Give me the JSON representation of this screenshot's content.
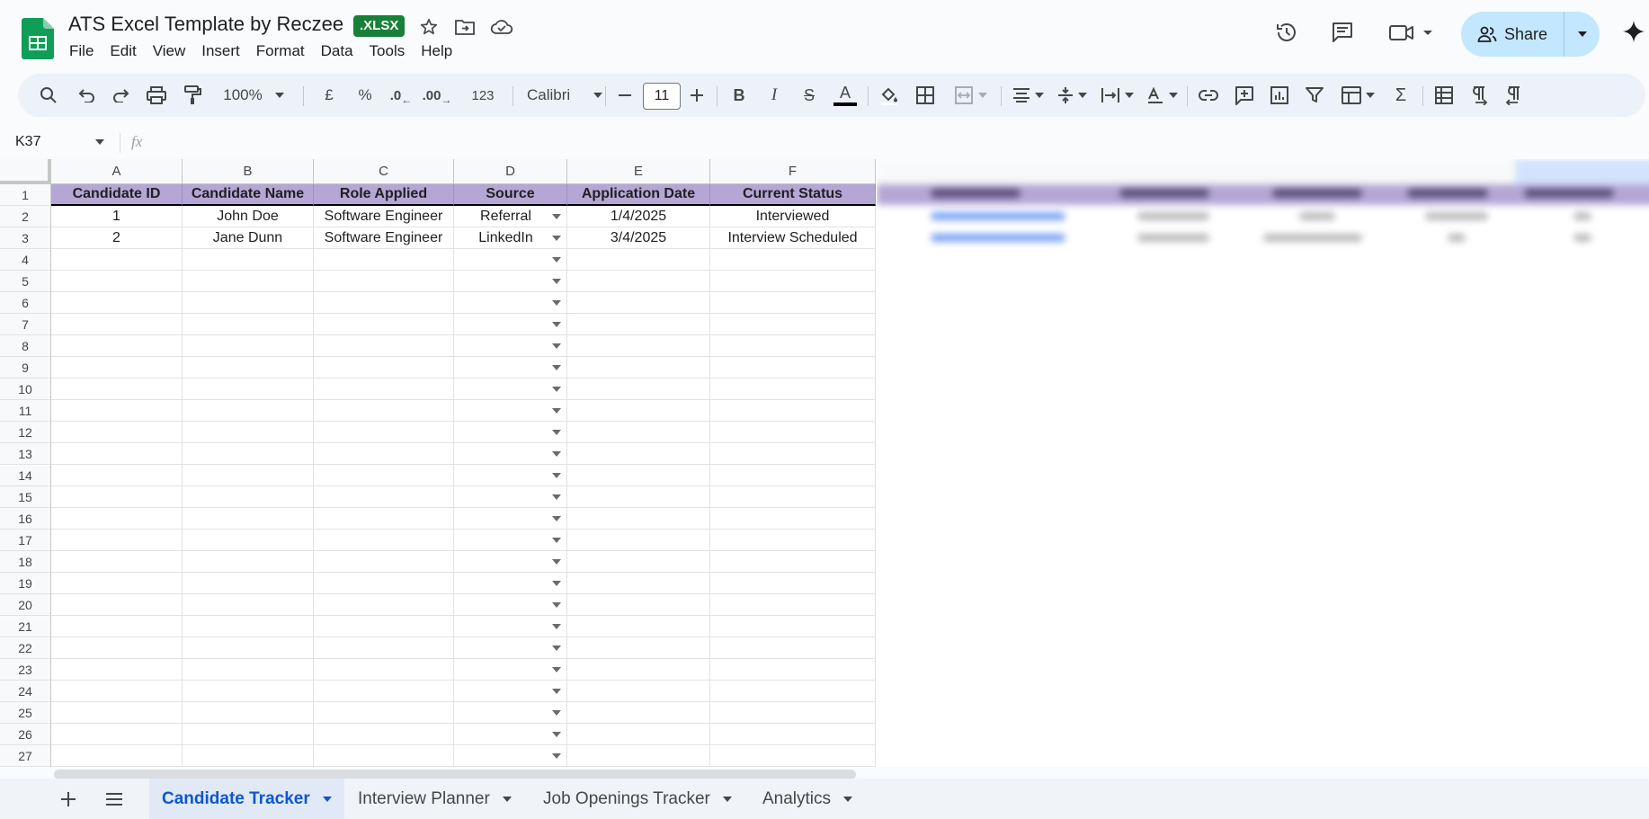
{
  "app": {
    "title": "ATS Excel Template by Reczee",
    "file_badge": ".XLSX",
    "menu": [
      "File",
      "Edit",
      "View",
      "Insert",
      "Format",
      "Data",
      "Tools",
      "Help"
    ],
    "share_label": "Share",
    "icons": [
      "sheets-logo-icon",
      "star-icon",
      "move-folder-icon",
      "cloud-saved-icon",
      "version-history-icon",
      "comments-icon",
      "meet-icon",
      "gemini-icon"
    ]
  },
  "toolbar": {
    "zoom": "100%",
    "currency": "£",
    "percent": "%",
    "dec_decrease": ".0",
    "dec_increase": ".00",
    "number_format": "123",
    "font": "Calibri",
    "font_size": "11"
  },
  "formula_bar": {
    "cell_ref": "K37",
    "fx": "fx",
    "value": ""
  },
  "sheet": {
    "columns": [
      "A",
      "B",
      "C",
      "D",
      "E",
      "F"
    ],
    "header": [
      "Candidate ID",
      "Candidate Name",
      "Role Applied",
      "Source",
      "Application Date",
      "Current Status"
    ],
    "rows": [
      [
        "1",
        "John Doe",
        "Software Engineer",
        "Referral",
        "1/4/2025",
        "Interviewed"
      ],
      [
        "2",
        "Jane Dunn",
        "Software Engineer",
        "LinkedIn",
        "3/4/2025",
        "Interview Scheduled"
      ]
    ],
    "row_numbers": [
      "1",
      "2",
      "3",
      "4",
      "5",
      "6",
      "7",
      "8",
      "9",
      "10",
      "11",
      "12",
      "13",
      "14",
      "15",
      "16",
      "17",
      "18",
      "19",
      "20",
      "21",
      "22",
      "23",
      "24",
      "25",
      "26",
      "27"
    ],
    "header_color": "#b4a7d6"
  },
  "tabs": [
    {
      "label": "Candidate Tracker",
      "active": true
    },
    {
      "label": "Interview Planner",
      "active": false
    },
    {
      "label": "Job Openings Tracker",
      "active": false
    },
    {
      "label": "Analytics",
      "active": false
    }
  ]
}
